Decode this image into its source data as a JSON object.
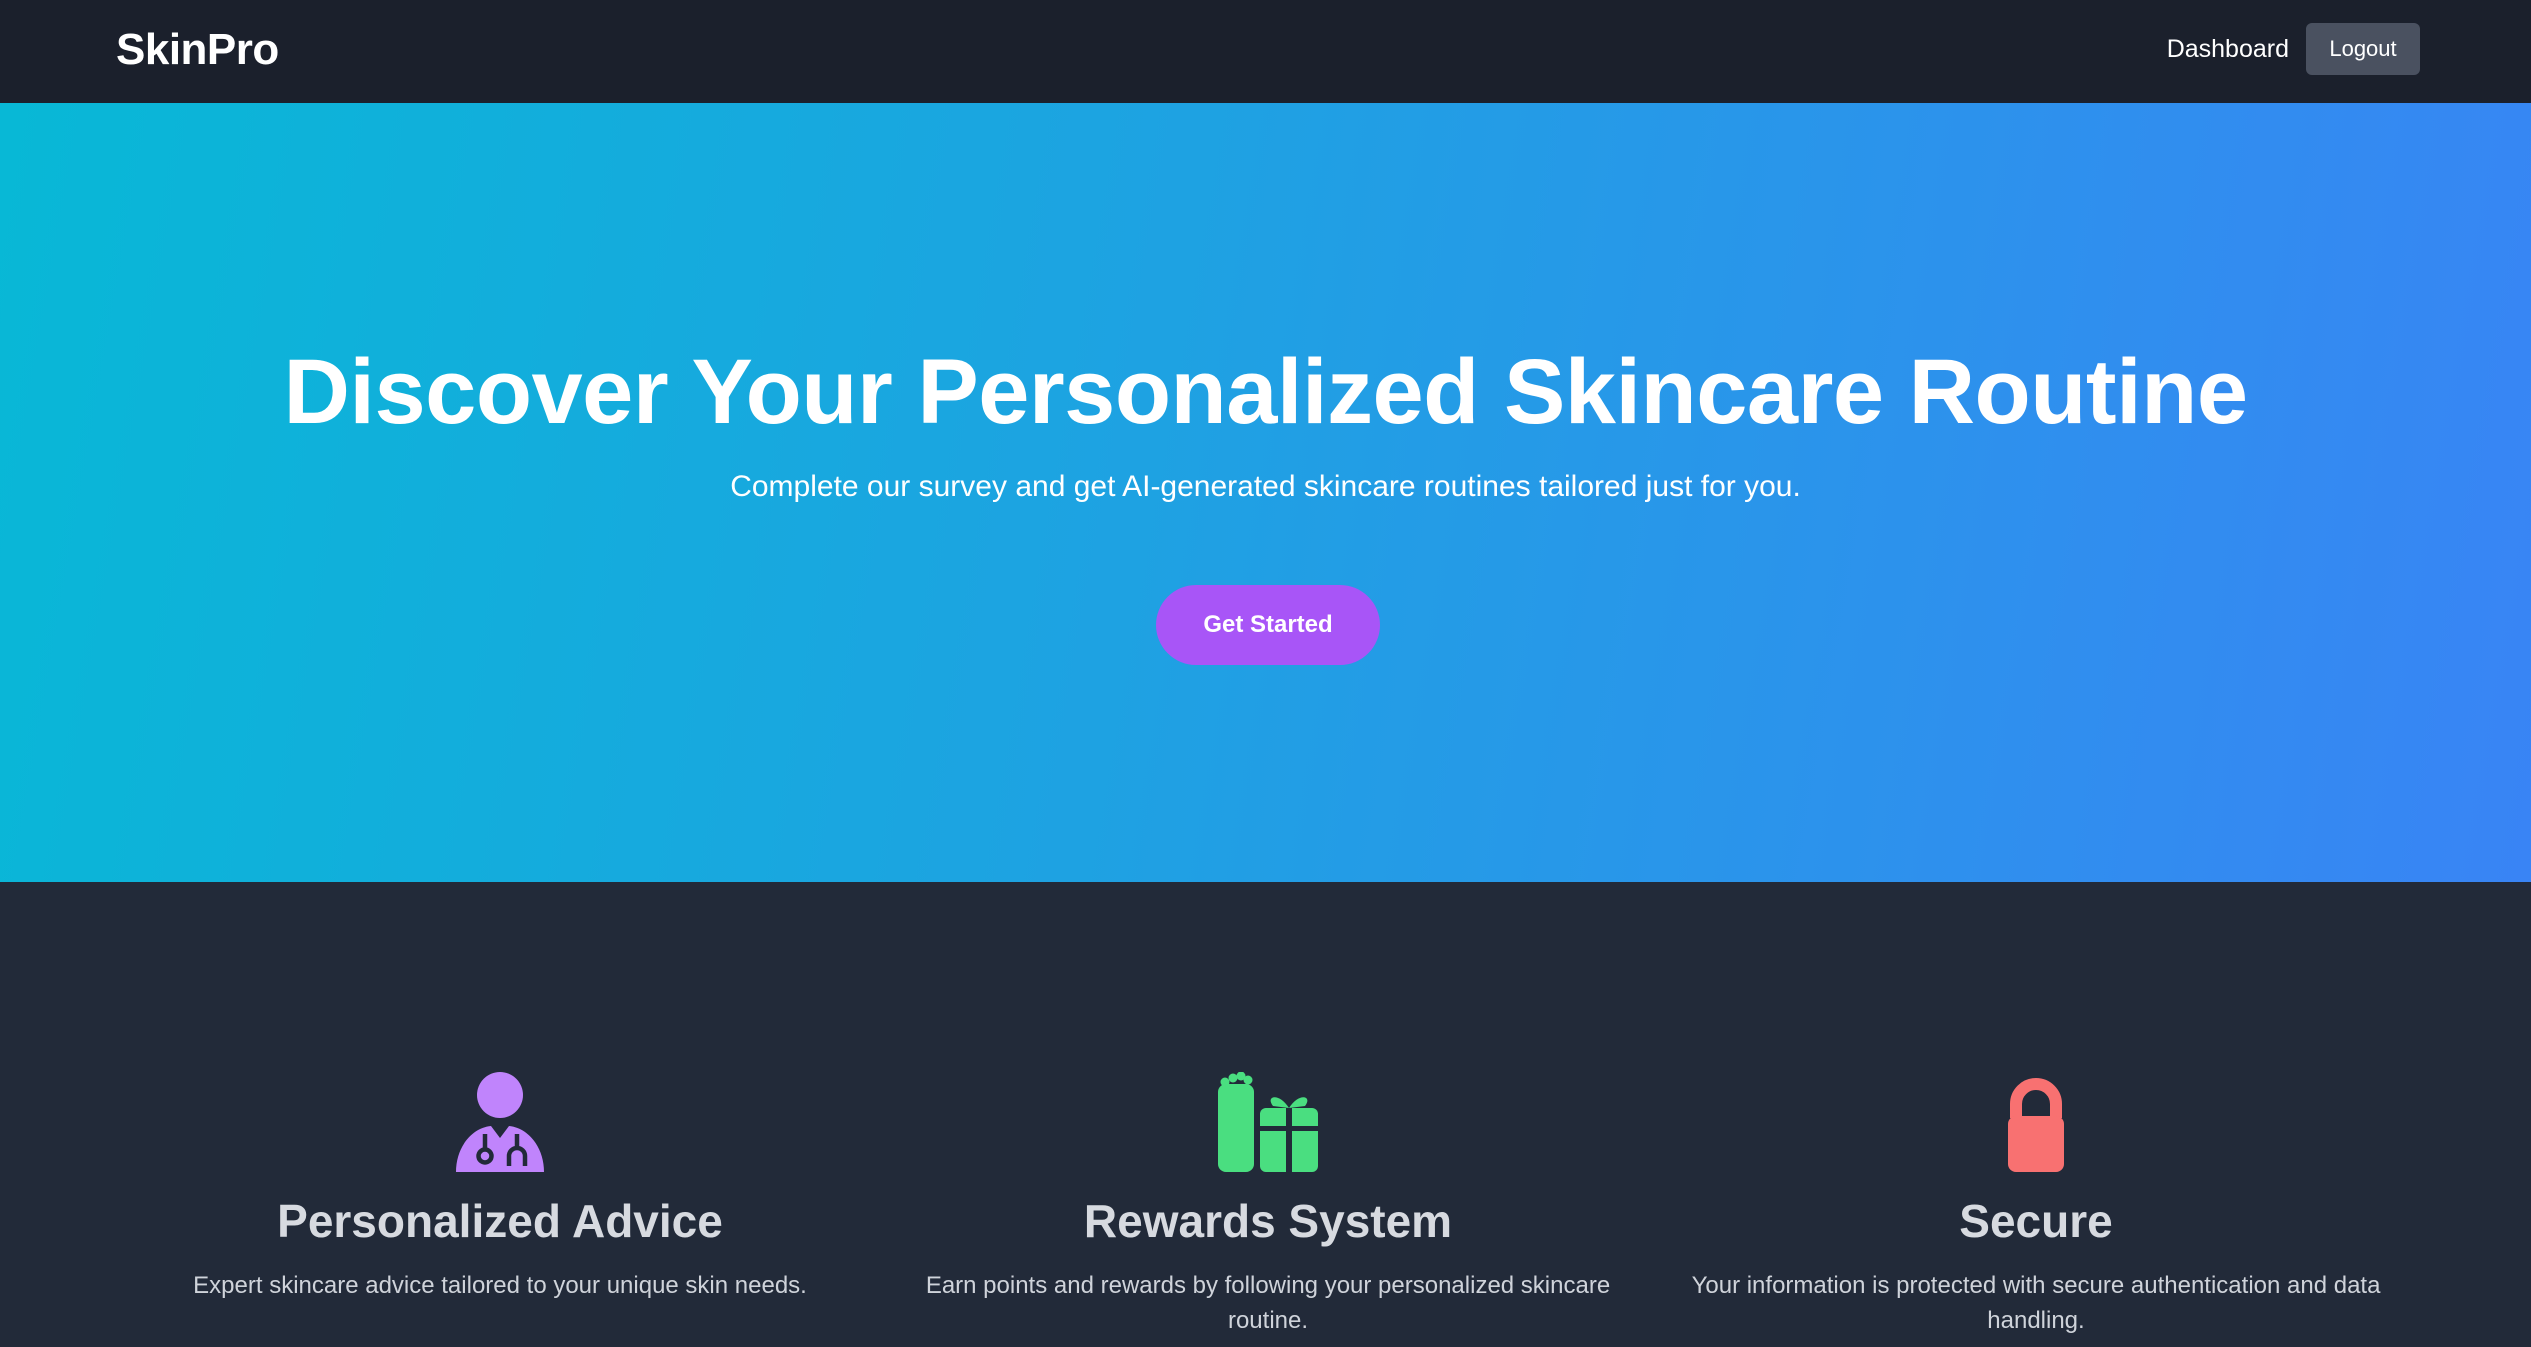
{
  "nav": {
    "brand": "SkinPro",
    "dashboard_label": "Dashboard",
    "logout_label": "Logout"
  },
  "hero": {
    "title": "Discover Your Personalized Skincare Routine",
    "subtitle": "Complete our survey and get AI-generated skincare routines tailored just for you.",
    "cta_label": "Get Started",
    "gradient_start": "#06b6d4",
    "gradient_end": "#3b82f6"
  },
  "features": [
    {
      "icon": "user-doctor-icon",
      "icon_color": "#c084fc",
      "title": "Personalized Advice",
      "description": "Expert skincare advice tailored to your unique skin needs."
    },
    {
      "icon": "gift-icon",
      "icon_color": "#4ade80",
      "title": "Rewards System",
      "description": "Earn points and rewards by following your personalized skincare routine."
    },
    {
      "icon": "lock-icon",
      "icon_color": "#f87171",
      "title": "Secure",
      "description": "Your information is protected with secure authentication and data handling."
    }
  ],
  "colors": {
    "navbar_bg": "#1b202c",
    "page_bg": "#222a39",
    "cta_bg": "#a855f7",
    "logout_bg": "#4a5160"
  }
}
